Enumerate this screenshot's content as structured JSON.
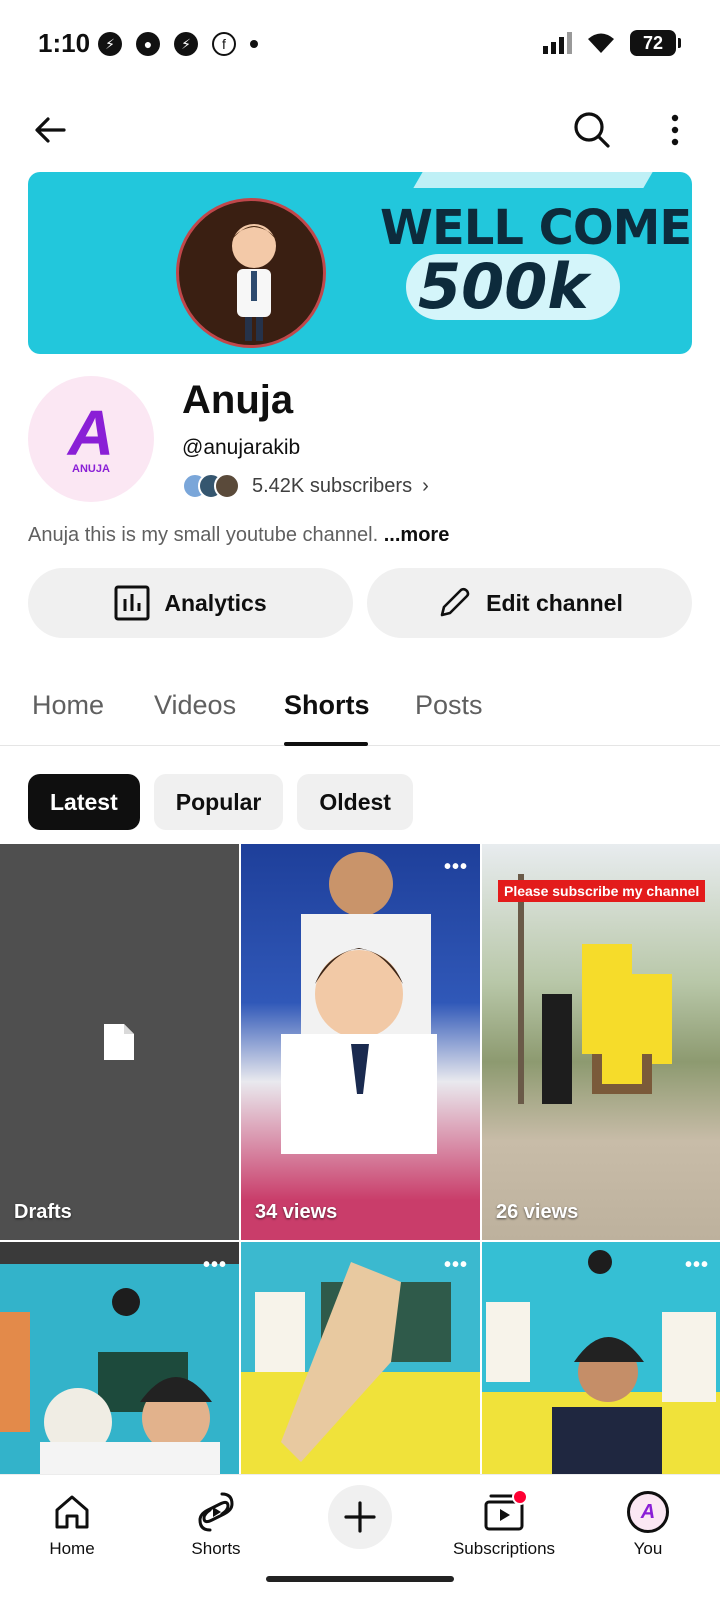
{
  "status_bar": {
    "time": "1:10",
    "battery": "72"
  },
  "banner": {
    "title": "WELL COME",
    "subtitle": "500k"
  },
  "channel": {
    "avatar_text": "ANUJA",
    "name": "Anuja",
    "handle": "@anujarakib",
    "subscribers": "5.42K subscribers",
    "description": "Anuja this is my small youtube channel.",
    "more_label": "...more"
  },
  "actions": {
    "analytics": "Analytics",
    "edit": "Edit channel"
  },
  "tabs": [
    {
      "label": "Home"
    },
    {
      "label": "Videos"
    },
    {
      "label": "Shorts"
    },
    {
      "label": "Posts"
    }
  ],
  "chips": [
    {
      "label": "Latest"
    },
    {
      "label": "Popular"
    },
    {
      "label": "Oldest"
    }
  ],
  "shorts": [
    {
      "caption": "Drafts"
    },
    {
      "caption": "34 views"
    },
    {
      "caption": "26 views",
      "overlay": "Please subscribe my channel"
    },
    {
      "caption": ""
    },
    {
      "caption": ""
    },
    {
      "caption": ""
    }
  ],
  "bottom_nav": {
    "home": "Home",
    "shorts": "Shorts",
    "subscriptions": "Subscriptions",
    "you": "You"
  },
  "colors": {
    "banner_bg": "#22c7dc",
    "accent": "#8a1fd6",
    "notification": "#ff0033"
  }
}
